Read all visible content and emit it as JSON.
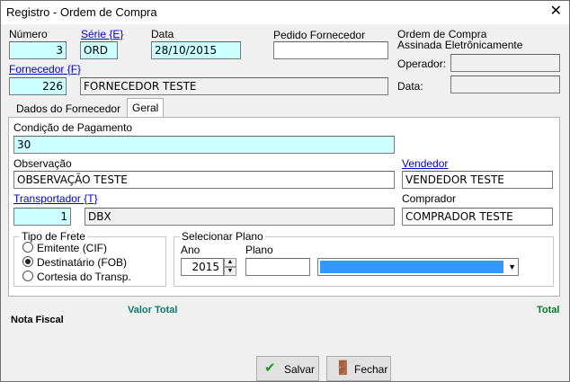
{
  "window": {
    "title": "Registro - Ordem de Compra",
    "close_glyph": "✕"
  },
  "header": {
    "numero_label": "Número",
    "numero_value": "3",
    "serie_label": "Série {E}",
    "serie_value": "ORD",
    "data_label": "Data",
    "data_value": "28/10/2015",
    "pedido_label": "Pedido Fornecedor",
    "pedido_value": "",
    "assinada_label": "Ordem de Compra Assinada Eletrônicamente",
    "operador_label": "Operador:",
    "operador_value": "",
    "data2_label": "Data:",
    "data2_value": "",
    "fornecedor_label": "Fornecedor {F}",
    "fornecedor_code": "226",
    "fornecedor_name": "FORNECEDOR TESTE"
  },
  "tabs": [
    {
      "label": "Dados do Fornecedor",
      "active": false
    },
    {
      "label": "Geral",
      "active": true
    }
  ],
  "geral": {
    "condicao_label": "Condição de  Pagamento",
    "condicao_value": "30",
    "observacao_label": "Observação",
    "observacao_value": "OBSERVAÇÃO TESTE",
    "vendedor_label": "Vendedor",
    "vendedor_value": "VENDEDOR TESTE",
    "transportador_label": "Transportador {T}",
    "transportador_code": "1",
    "transportador_name": "DBX",
    "comprador_label": "Comprador",
    "comprador_value": "COMPRADOR TESTE",
    "frete": {
      "title": "Tipo de Frete",
      "options": [
        {
          "label": "Emitente (CIF)",
          "selected": false
        },
        {
          "label": "Destinatário (FOB)",
          "selected": true
        },
        {
          "label": "Cortesia do Transp.",
          "selected": false
        }
      ]
    },
    "plano": {
      "title": "Selecionar Plano",
      "ano_label": "Ano",
      "ano_value": "2015",
      "plano_label": "Plano",
      "plano_value": "",
      "combo_value": ""
    }
  },
  "totals": {
    "valor_total_label": "Valor Total",
    "total_label": "Total",
    "nota_fiscal_label": "Nota Fiscal",
    "accent_color": "#0a7a6e"
  },
  "footer": {
    "salvar_label": "Salvar",
    "fechar_label": "Fechar",
    "salvar_icon": "check-icon",
    "fechar_icon": "door-icon"
  }
}
